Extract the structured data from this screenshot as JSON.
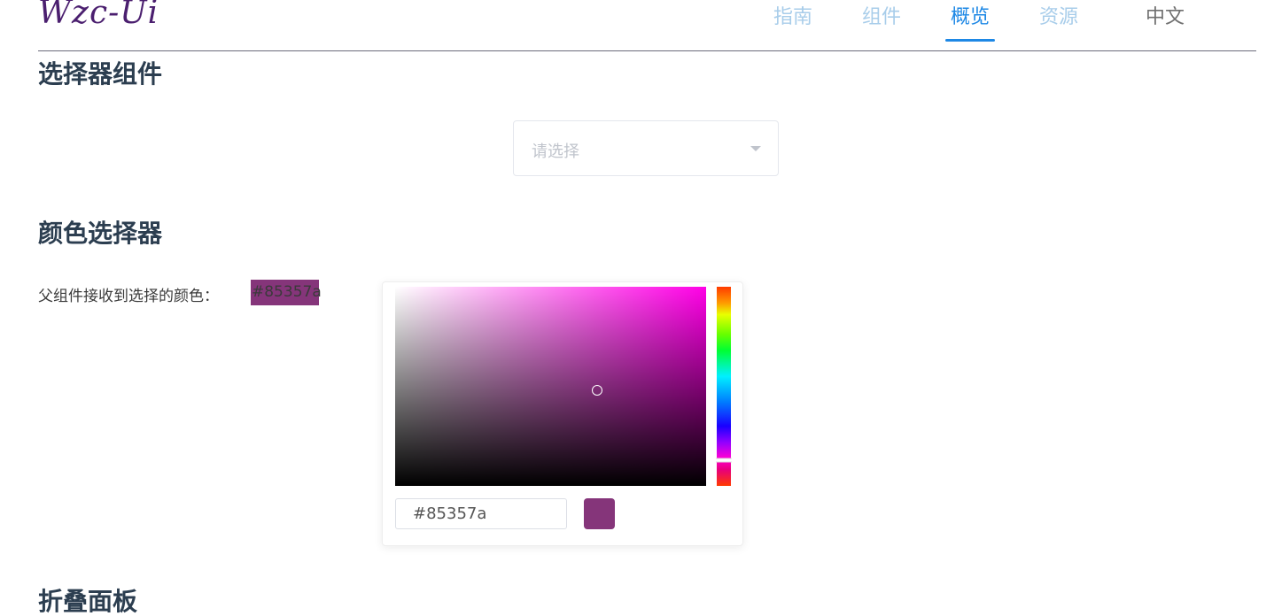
{
  "header": {
    "logo": "Wzc-Ui",
    "nav": [
      {
        "label": "指南",
        "active": false
      },
      {
        "label": "组件",
        "active": false
      },
      {
        "label": "概览",
        "active": true
      },
      {
        "label": "资源",
        "active": false
      }
    ],
    "language": "中文"
  },
  "sections": {
    "select_title": "选择器组件",
    "color_title": "颜色选择器",
    "collapse_title": "折叠面板"
  },
  "select": {
    "placeholder": "请选择"
  },
  "color_picker": {
    "parent_label": "父组件接收到选择的颜色：",
    "selected_color": "#85357a",
    "hex_value": "#85357a",
    "hue_color": "#ff00e6",
    "saturation": 0.65,
    "value": 0.48,
    "hue_position": 0.87
  },
  "colors": {
    "accent": "#1e88e5",
    "nav_inactive": "#a8cdea",
    "logo": "#4b1f6f"
  }
}
